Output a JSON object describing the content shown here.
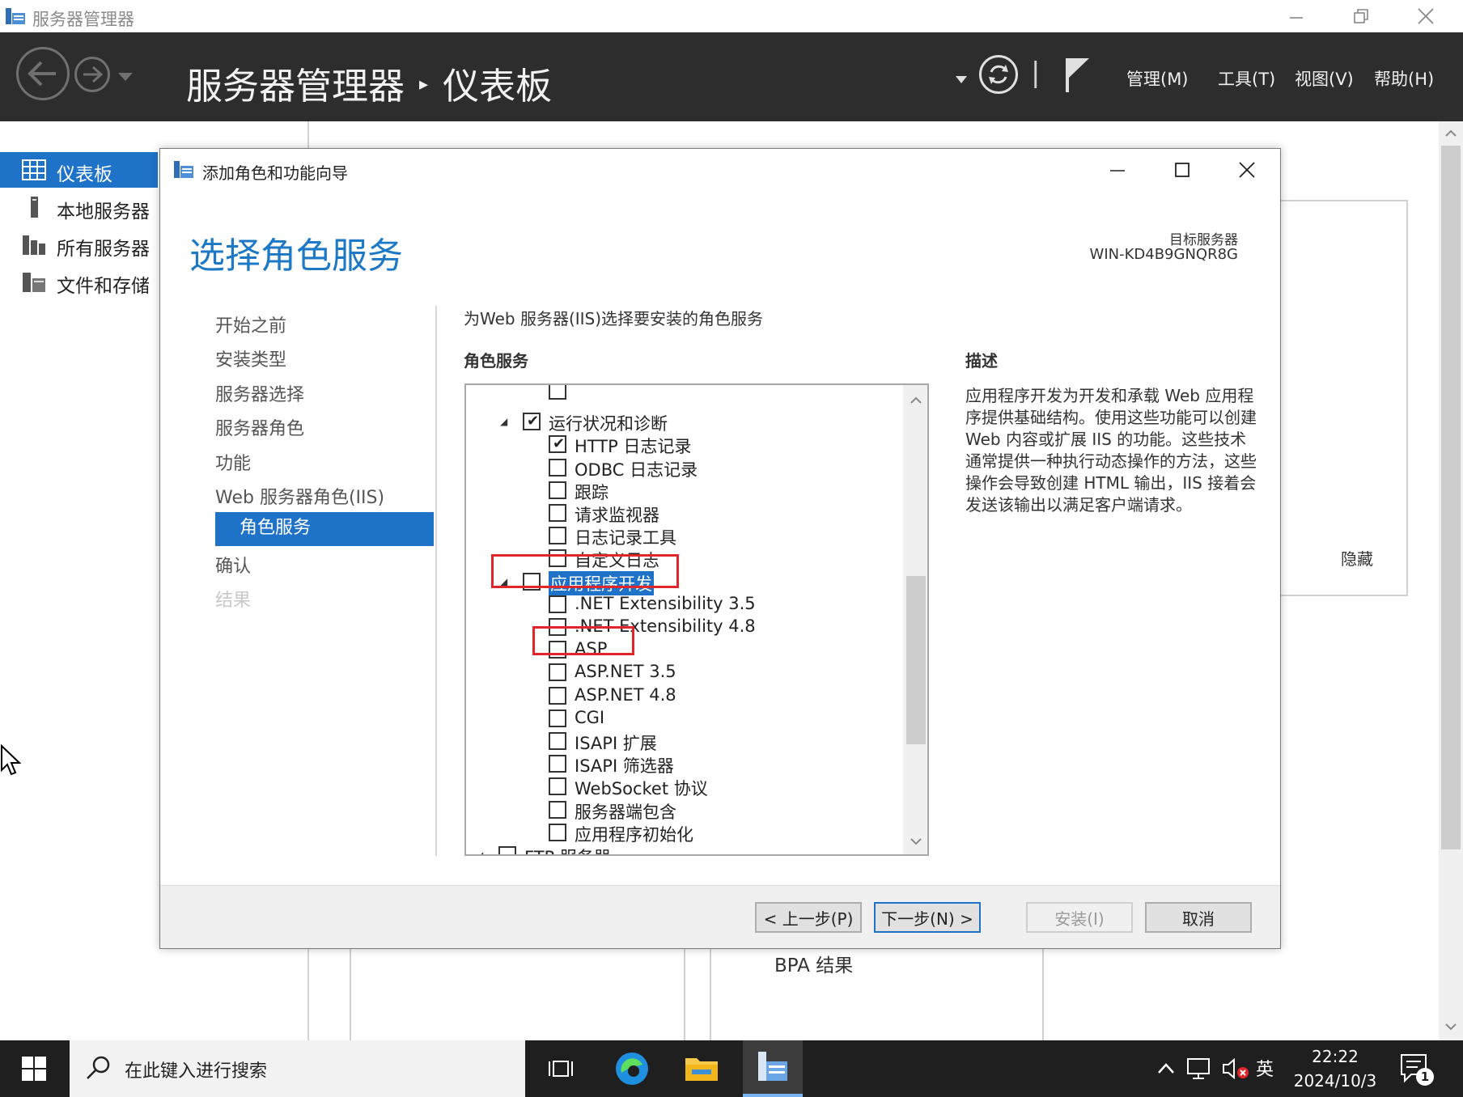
{
  "app": {
    "title": "服务器管理器"
  },
  "header": {
    "breadcrumb_root": "服务器管理器",
    "breadcrumb_separator": "▸",
    "breadcrumb_current": "仪表板",
    "separator_bar": "|",
    "menu": {
      "manage": "管理(M)",
      "tools": "工具(T)",
      "view": "视图(V)",
      "help": "帮助(H)"
    }
  },
  "sidebar": {
    "items": [
      {
        "label": "仪表板",
        "icon": "dashboard-grid-icon",
        "active": true
      },
      {
        "label": "本地服务器",
        "icon": "server-tower-icon",
        "active": false
      },
      {
        "label": "所有服务器",
        "icon": "servers-icon",
        "active": false
      },
      {
        "label": "文件和存储",
        "icon": "file-storage-icon",
        "active": false
      }
    ]
  },
  "background": {
    "hide_label": "隐藏",
    "bpa_results": "BPA 结果"
  },
  "wizard": {
    "title": "添加角色和功能向导",
    "page_title": "选择角色服务",
    "target_server_label": "目标服务器",
    "target_server_name": "WIN-KD4B9GNQR8G",
    "steps": [
      {
        "label": "开始之前",
        "state": "normal"
      },
      {
        "label": "安装类型",
        "state": "normal"
      },
      {
        "label": "服务器选择",
        "state": "normal"
      },
      {
        "label": "服务器角色",
        "state": "normal"
      },
      {
        "label": "功能",
        "state": "normal"
      },
      {
        "label": "Web 服务器角色(IIS)",
        "state": "normal"
      },
      {
        "label": "角色服务",
        "state": "active"
      },
      {
        "label": "确认",
        "state": "normal"
      },
      {
        "label": "结果",
        "state": "disabled"
      }
    ],
    "instruction": "为Web 服务器(IIS)选择要安装的角色服务",
    "role_services_heading": "角色服务",
    "description_heading": "描述",
    "description_text": "应用程序开发为开发和承载 Web 应用程序提供基础结构。使用这些功能可以创建 Web 内容或扩展 IIS 的功能。这些技术通常提供一种执行动态操作的方法，这些操作会导致创建 HTML 输出，IIS 接着会发送该输出以满足客户端请求。",
    "tree": [
      {
        "label": "",
        "level": 2,
        "checked": false,
        "expander": false,
        "partial_top": true
      },
      {
        "label": "运行状况和诊断",
        "level": 1,
        "checked": true,
        "expander": true
      },
      {
        "label": "HTTP 日志记录",
        "level": 2,
        "checked": true,
        "expander": false
      },
      {
        "label": "ODBC 日志记录",
        "level": 2,
        "checked": false,
        "expander": false
      },
      {
        "label": "跟踪",
        "level": 2,
        "checked": false,
        "expander": false
      },
      {
        "label": "请求监视器",
        "level": 2,
        "checked": false,
        "expander": false
      },
      {
        "label": "日志记录工具",
        "level": 2,
        "checked": false,
        "expander": false
      },
      {
        "label": "自定义日志",
        "level": 2,
        "checked": false,
        "expander": false
      },
      {
        "label": "应用程序开发",
        "level": 1,
        "checked": false,
        "expander": true,
        "selected": true
      },
      {
        "label": ".NET Extensibility 3.5",
        "level": 2,
        "checked": false,
        "expander": false
      },
      {
        "label": ".NET Extensibility 4.8",
        "level": 2,
        "checked": false,
        "expander": false
      },
      {
        "label": "ASP",
        "level": 2,
        "checked": false,
        "expander": false
      },
      {
        "label": "ASP.NET 3.5",
        "level": 2,
        "checked": false,
        "expander": false
      },
      {
        "label": "ASP.NET 4.8",
        "level": 2,
        "checked": false,
        "expander": false
      },
      {
        "label": "CGI",
        "level": 2,
        "checked": false,
        "expander": false
      },
      {
        "label": "ISAPI 扩展",
        "level": 2,
        "checked": false,
        "expander": false
      },
      {
        "label": "ISAPI 筛选器",
        "level": 2,
        "checked": false,
        "expander": false
      },
      {
        "label": "WebSocket 协议",
        "level": 2,
        "checked": false,
        "expander": false
      },
      {
        "label": "服务器端包含",
        "level": 2,
        "checked": false,
        "expander": false
      },
      {
        "label": "应用程序初始化",
        "level": 2,
        "checked": false,
        "expander": false
      },
      {
        "label": "FTP 服务器",
        "level": 0,
        "checked": false,
        "expander": true
      }
    ],
    "buttons": {
      "previous": "< 上一步(P)",
      "next": "下一步(N) >",
      "install": "安装(I)",
      "cancel": "取消"
    }
  },
  "taskbar": {
    "search_placeholder": "在此键入进行搜索",
    "ime": "英",
    "time": "22:22",
    "date": "2024/10/3",
    "notification_count": "1"
  },
  "colors": {
    "accent": "#1e73c8",
    "header_bg": "#2d2d2d",
    "highlight_box": "#e0262b"
  }
}
